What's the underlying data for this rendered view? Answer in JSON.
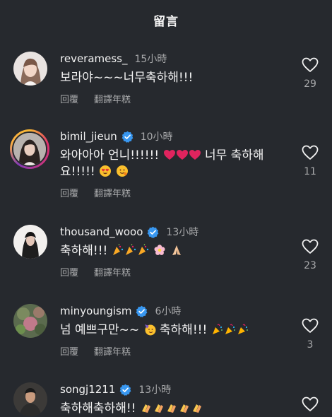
{
  "header": {
    "title": "留言"
  },
  "actions": {
    "reply": "回覆",
    "translate": "翻譯年糕"
  },
  "comments": [
    {
      "username": "reveramess_",
      "time": "15小時",
      "text": "보라야~~~너무축하해!!!",
      "likes": "29"
    },
    {
      "username": "bimil_jieun",
      "time": "10小時",
      "text_a": "와아아아 언니!!!!!!",
      "text_b": "너무 축하해요!!!!!",
      "likes": "11"
    },
    {
      "username": "thousand_wooo",
      "time": "13小時",
      "text": "축하해!!!",
      "likes": "23"
    },
    {
      "username": "minyoungism",
      "time": "6小時",
      "text_a": "넘 예쁘구만~~",
      "text_b": "축하해!!!",
      "likes": "3"
    },
    {
      "username": "songj1211",
      "time": "13小時",
      "text": "축하해축하해!!",
      "likes": ""
    }
  ],
  "colors": {
    "background": "#26292e",
    "verified": "#3897f0",
    "heart": "#e0245e",
    "muted": "#a8a9ab"
  }
}
